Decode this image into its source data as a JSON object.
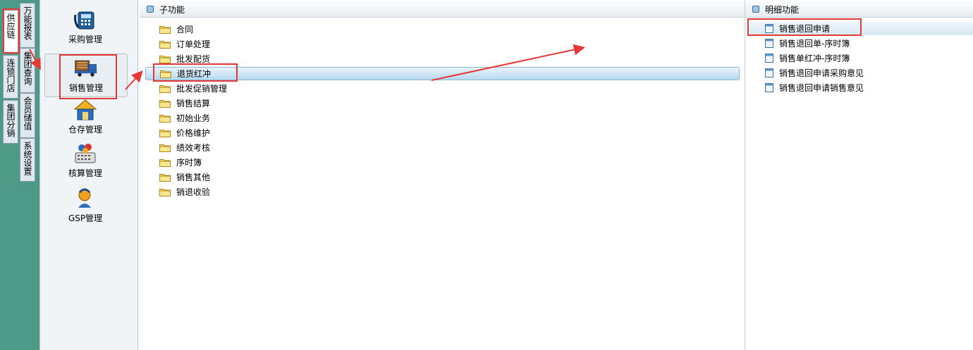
{
  "left_tabs": {
    "col1": [
      "供应链",
      "连锁门店",
      "集团分销"
    ],
    "col2": [
      "万能报表",
      "集团查询",
      "会员储值",
      "系统设置"
    ]
  },
  "modules": [
    {
      "label": "采购管理",
      "icon": "phone-calculator-icon"
    },
    {
      "label": "销售管理",
      "icon": "delivery-truck-icon"
    },
    {
      "label": "仓存管理",
      "icon": "warehouse-house-icon"
    },
    {
      "label": "核算管理",
      "icon": "accounting-keyboard-icon"
    },
    {
      "label": "GSP管理",
      "icon": "gsp-person-icon"
    }
  ],
  "subfunctions": {
    "title": "子功能",
    "items": [
      "合同",
      "订单处理",
      "批发配货",
      "退货红冲",
      "批发促销管理",
      "销售结算",
      "初始业务",
      "价格维护",
      "绩效考核",
      "序时簿",
      "销售其他",
      "销退收验"
    ],
    "selected": "退货红冲"
  },
  "details": {
    "title": "明细功能",
    "items": [
      "销售退回申请",
      "销售退回单-序时簿",
      "销售单红冲-序时簿",
      "销售退回申请采购意见",
      "销售退回申请销售意见"
    ],
    "selected": "销售退回申请"
  },
  "colors": {
    "annotation_red": "#e53935",
    "sidebar_green": "#4d9a86"
  }
}
